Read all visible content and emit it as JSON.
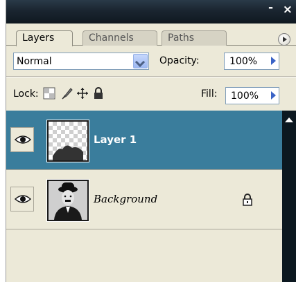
{
  "window": {
    "minimize_label": "-",
    "close_label": "×"
  },
  "tabs": [
    {
      "label": "Layers",
      "active": true
    },
    {
      "label": "Channels",
      "active": false
    },
    {
      "label": "Paths",
      "active": false
    }
  ],
  "icons": {
    "panel_menu": "panel-menu-icon",
    "visibility": "eye-icon",
    "lock_transparent": "lock-transparent-pixels-icon",
    "lock_image": "lock-image-pixels-icon",
    "lock_position": "lock-position-icon",
    "lock_all": "lock-all-icon"
  },
  "blend_mode": {
    "value": "Normal"
  },
  "opacity": {
    "label": "Opacity:",
    "value": "100%"
  },
  "lock": {
    "label": "Lock:"
  },
  "fill": {
    "label": "Fill:",
    "value": "100%"
  },
  "layers": [
    {
      "name": "Layer 1",
      "selected": true,
      "visible": true,
      "locked": false
    },
    {
      "name": "Background",
      "selected": false,
      "visible": true,
      "locked": true
    }
  ],
  "colors": {
    "selection": "#3a7d9c",
    "panel_bg": "#ece9d8",
    "title_bar": "#1a2530"
  }
}
